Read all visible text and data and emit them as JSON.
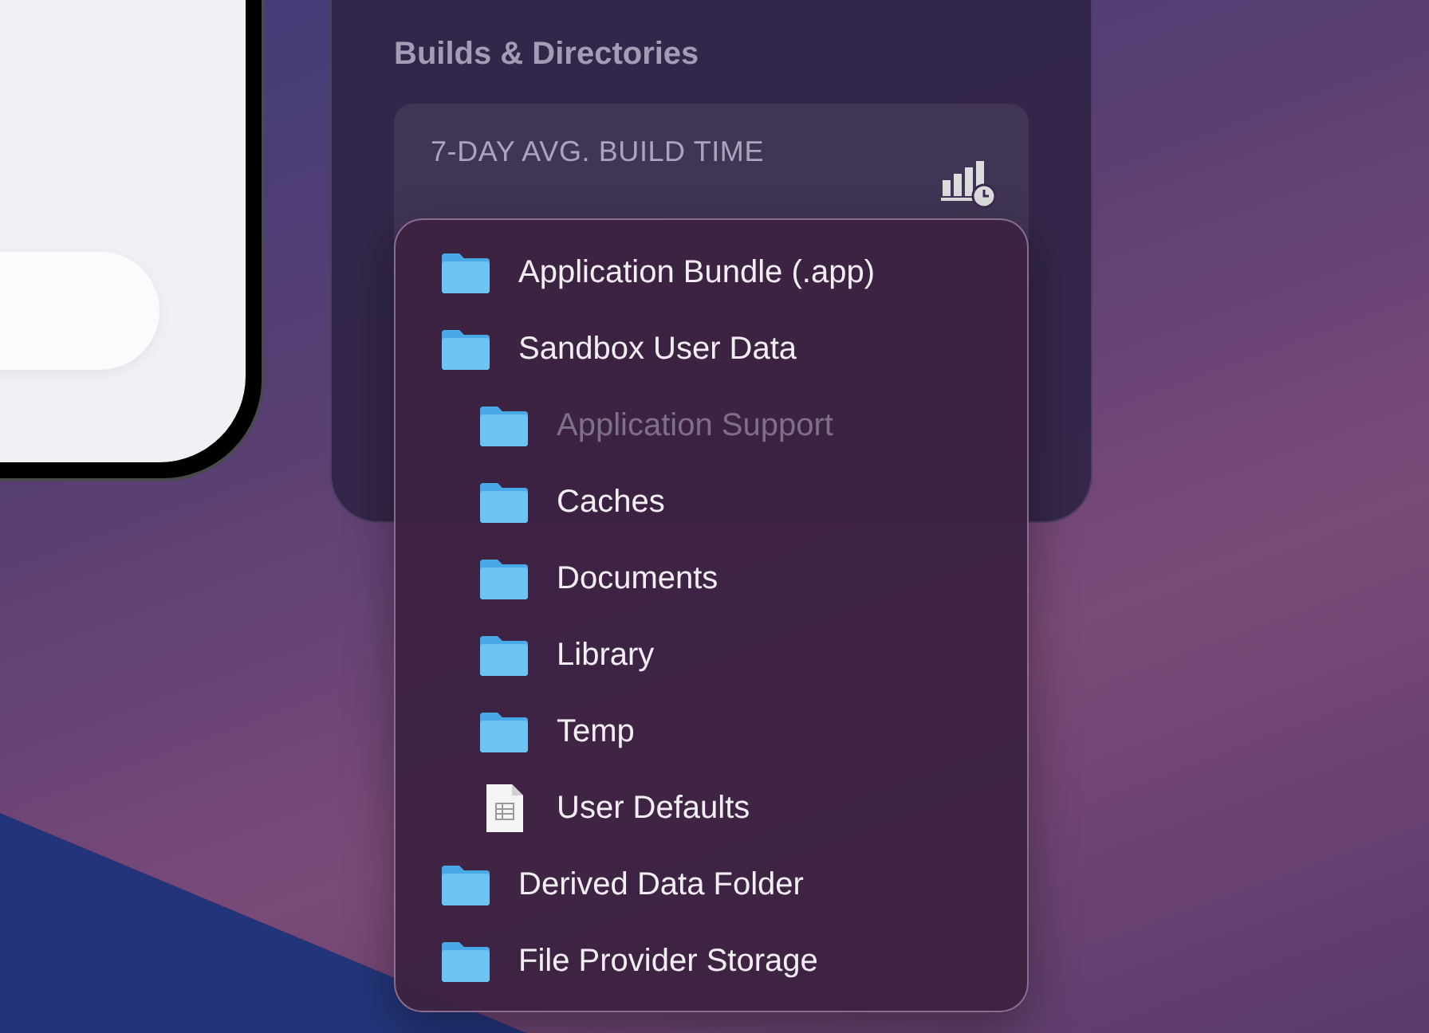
{
  "panel": {
    "section_title": "Builds & Directories",
    "card": {
      "label": "7-DAY AVG. BUILD TIME"
    }
  },
  "menu": {
    "items": [
      {
        "label": "Application Bundle (.app)",
        "kind": "folder",
        "disabled": false
      },
      {
        "label": "Sandbox User Data",
        "kind": "folder",
        "disabled": false,
        "children": [
          {
            "label": "Application Support",
            "kind": "folder",
            "disabled": true
          },
          {
            "label": "Caches",
            "kind": "folder",
            "disabled": false
          },
          {
            "label": "Documents",
            "kind": "folder",
            "disabled": false
          },
          {
            "label": "Library",
            "kind": "folder",
            "disabled": false
          },
          {
            "label": "Temp",
            "kind": "folder",
            "disabled": false
          },
          {
            "label": "User Defaults",
            "kind": "document",
            "disabled": false
          }
        ]
      },
      {
        "label": "Derived Data Folder",
        "kind": "folder",
        "disabled": false
      },
      {
        "label": "File Provider Storage",
        "kind": "folder",
        "disabled": false
      }
    ]
  }
}
